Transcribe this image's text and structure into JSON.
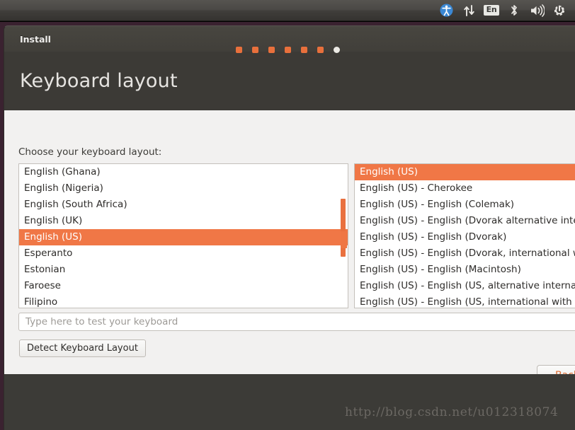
{
  "panel": {
    "icons": [
      {
        "name": "accessibility-icon",
        "label": "accessibility"
      },
      {
        "name": "network-icon",
        "label": "network"
      },
      {
        "name": "keyboard-layout-indicator",
        "label": "En"
      },
      {
        "name": "bluetooth-icon",
        "label": "bluetooth"
      },
      {
        "name": "volume-icon",
        "label": "volume"
      },
      {
        "name": "session-power-icon",
        "label": "session"
      }
    ]
  },
  "window": {
    "title": "Install",
    "page_heading": "Keyboard layout"
  },
  "main": {
    "choose_label": "Choose your keyboard layout:",
    "left_list": [
      {
        "label": "English (Ghana)",
        "selected": false
      },
      {
        "label": "English (Nigeria)",
        "selected": false
      },
      {
        "label": "English (South Africa)",
        "selected": false
      },
      {
        "label": "English (UK)",
        "selected": false
      },
      {
        "label": "English (US)",
        "selected": true
      },
      {
        "label": "Esperanto",
        "selected": false
      },
      {
        "label": "Estonian",
        "selected": false
      },
      {
        "label": "Faroese",
        "selected": false
      },
      {
        "label": "Filipino",
        "selected": false
      }
    ],
    "right_list": [
      {
        "label": "English (US)",
        "selected": true
      },
      {
        "label": "English (US) - Cherokee",
        "selected": false
      },
      {
        "label": "English (US) - English (Colemak)",
        "selected": false
      },
      {
        "label": "English (US) - English (Dvorak alternative international no dead keys)",
        "selected": false
      },
      {
        "label": "English (US) - English (Dvorak)",
        "selected": false
      },
      {
        "label": "English (US) - English (Dvorak, international with dead keys)",
        "selected": false
      },
      {
        "label": "English (US) - English (Macintosh)",
        "selected": false
      },
      {
        "label": "English (US) - English (US, alternative international)",
        "selected": false
      },
      {
        "label": "English (US) - English (US, international with dead keys)",
        "selected": false
      }
    ],
    "test_input_placeholder": "Type here to test your keyboard",
    "detect_button": "Detect Keyboard Layout",
    "back_button": "Back"
  },
  "footer": {
    "dots": [
      {
        "active": false
      },
      {
        "active": false
      },
      {
        "active": false
      },
      {
        "active": false
      },
      {
        "active": false
      },
      {
        "active": false
      },
      {
        "active": true
      }
    ]
  },
  "watermark": "http://blog.csdn.net/u012318074",
  "colors": {
    "accent_orange": "#f07746",
    "panel_dark": "#403e3b",
    "window_dark": "#3c3a36",
    "content_light": "#f2f1f0",
    "desktop_maroon": "#3a2230",
    "back_text": "#dd6a30"
  }
}
